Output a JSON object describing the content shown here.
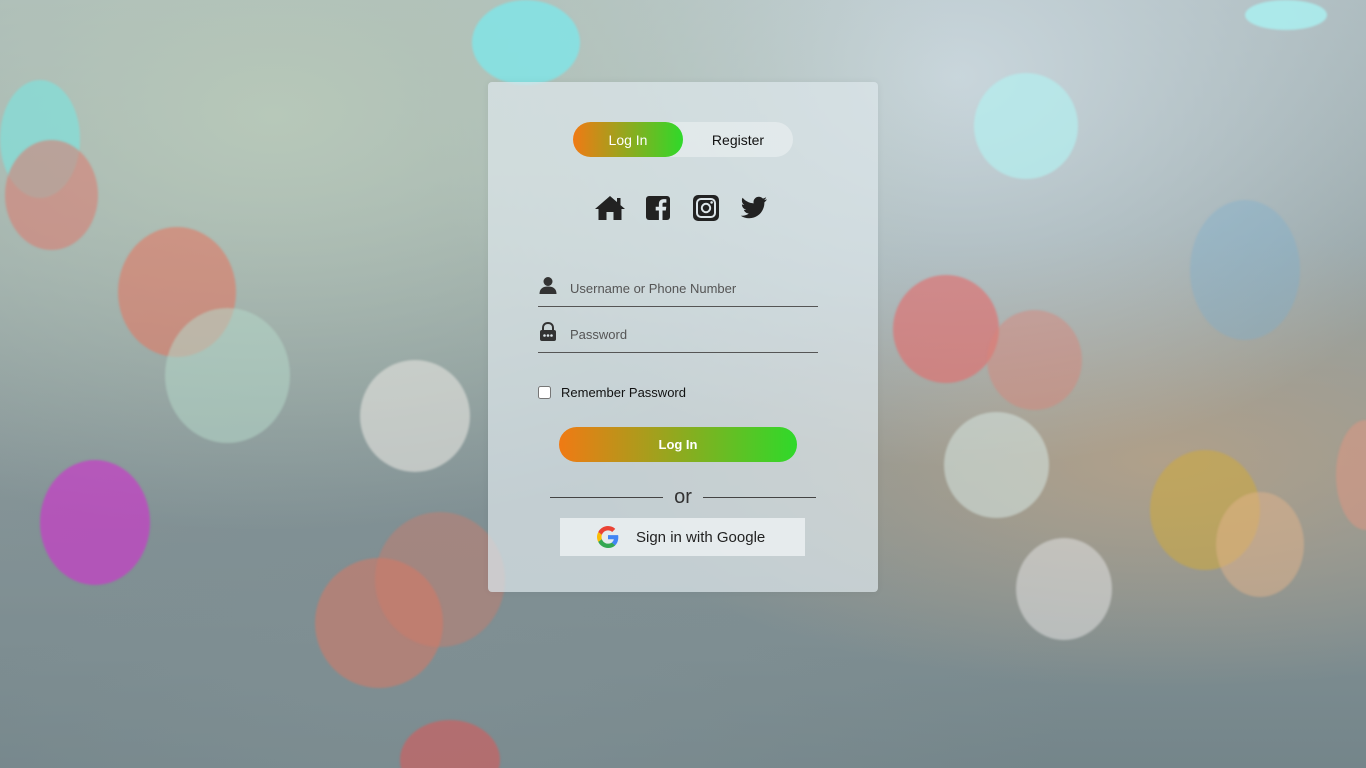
{
  "tabs": {
    "login_label": "Log In",
    "register_label": "Register"
  },
  "social_icons": [
    "home-icon",
    "facebook-icon",
    "instagram-icon",
    "twitter-icon"
  ],
  "form": {
    "username_placeholder": "Username or Phone Number",
    "username_value": "",
    "password_placeholder": "Password",
    "password_value": "",
    "remember_label": "Remember Password",
    "remember_checked": false,
    "submit_label": "Log In",
    "divider_text": "or",
    "google_label": "Sign in with Google"
  },
  "colors": {
    "gradient_start": "#f07a14",
    "gradient_end": "#2fd92a"
  }
}
